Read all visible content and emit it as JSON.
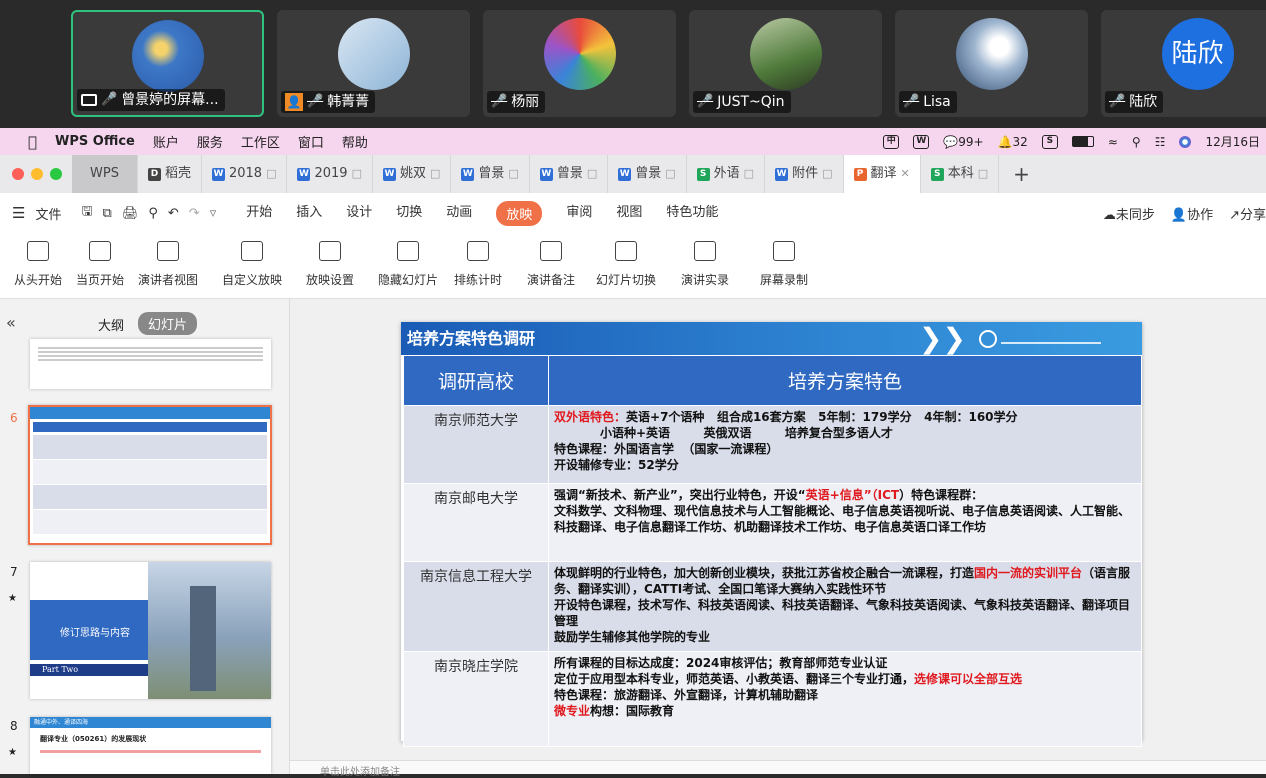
{
  "meeting": {
    "participants": [
      {
        "name": "曾景婷的屏幕...",
        "active": true,
        "muted": false,
        "avatar": "flower-photo"
      },
      {
        "name": "韩菁菁",
        "active": false,
        "muted": true,
        "avatar": "paper-photo"
      },
      {
        "name": "杨丽",
        "active": false,
        "muted": true,
        "avatar": "cartoon-girl"
      },
      {
        "name": "JUST~Qin",
        "active": false,
        "muted": true,
        "avatar": "plant-photo"
      },
      {
        "name": "Lisa",
        "active": false,
        "muted": true,
        "avatar": "clouds-photo"
      },
      {
        "name": "陆欣",
        "active": false,
        "muted": true,
        "avatar_text": "陆欣"
      }
    ]
  },
  "menubar": {
    "app": "WPS Office",
    "items": [
      "账户",
      "服务",
      "工作区",
      "窗口",
      "帮助"
    ],
    "status": {
      "wechat": "99+",
      "bell": "32",
      "date": "12月16日"
    }
  },
  "tabs": [
    "WPS",
    "稻壳",
    "2018",
    "2019",
    "姚双",
    "曾景",
    "曾景",
    "曾景",
    "外语",
    "附件",
    "翻译",
    "本科"
  ],
  "menu": {
    "file": "文件",
    "items": [
      "开始",
      "插入",
      "设计",
      "切换",
      "动画",
      "放映",
      "审阅",
      "视图",
      "特色功能"
    ],
    "right": [
      "未同步",
      "协作",
      "分享"
    ]
  },
  "ribbon": [
    "从头开始",
    "当页开始",
    "演讲者视图",
    "自定义放映",
    "放映设置",
    "隐藏幻灯片",
    "排练计时",
    "演讲备注",
    "幻灯片切换",
    "演讲实录",
    "屏幕录制"
  ],
  "panel": {
    "tabs": [
      "大纲",
      "幻灯片"
    ],
    "numbers": [
      "6",
      "7",
      "8"
    ],
    "slide7_title": "修订思路与内容",
    "slide7_part": "Part Two",
    "slide8_title": "翻译专业（050261）的发展现状",
    "slide8_head": "融通中外、通译四海"
  },
  "notes_placeholder": "单击此处添加备注",
  "slide": {
    "title": "培养方案特色调研",
    "col1": "调研高校",
    "col2": "培养方案特色",
    "rows": [
      {
        "uni": "南京师范大学",
        "lines": [
          [
            [
              "双外语特色：",
              "red"
            ],
            [
              "英语+7个语种   组合成16套方案   5年制：179学分   4年制：160学分",
              ""
            ]
          ],
          [
            [
              "           小语种+英语        英俄双语        培养复合型多语人才",
              ""
            ]
          ],
          [
            [
              "特色课程：外国语言学  （国家一流课程）",
              ""
            ]
          ],
          [
            [
              "开设辅修专业：52学分",
              ""
            ]
          ]
        ]
      },
      {
        "uni": "南京邮电大学",
        "lines": [
          [
            [
              "强调“新技术、新产业”，突出行业特色，开设“",
              ""
            ],
            [
              "英语+信息”（ICT",
              ""
            ],
            [
              "）特色课程群：",
              ""
            ]
          ],
          [
            [
              "文科数学、文科物理、现代信息技术与人工智能概论、电子信息英语视听说、电子信息英语阅读、人工智能、科技翻译、电子信息翻译工作坊、机助翻译技术工作坊、电子信息英语口译工作坊",
              ""
            ]
          ]
        ]
      },
      {
        "uni": "南京信息工程大学",
        "lines": [
          [
            [
              "体现鲜明的行业特色，加大创新创业模块，获批江苏省校企融合一流课程，打造",
              ""
            ],
            [
              "国内一流的实训平台",
              ""
            ],
            [
              "（语言服务、翻译实训），CATTI考试、全国口笔译大赛纳入实践性环节",
              ""
            ]
          ],
          [
            [
              "开设特色课程，技术写作、科技英语阅读、科技英语翻译、气象科技英语阅读、气象科技英语翻译、翻译项目管理",
              ""
            ]
          ],
          [
            [
              "鼓励学生辅修其他学院的专业",
              ""
            ]
          ]
        ]
      },
      {
        "uni": "南京晓庄学院",
        "lines": [
          [
            [
              "所有课程的目标达成度：2024审核评估；教育部师范专业认证",
              ""
            ]
          ],
          [
            [
              "定位于应用型本科专业，师范英语、小教英语、翻译三个专业打通，",
              ""
            ],
            [
              "选修课可以全部互选",
              ""
            ]
          ],
          [
            [
              "特色课程：旅游翻译、外宣翻译，计算机辅助翻译",
              ""
            ]
          ],
          [
            [
              "微专业",
              ""
            ],
            [
              "构想：国际教育",
              ""
            ]
          ]
        ]
      }
    ]
  }
}
